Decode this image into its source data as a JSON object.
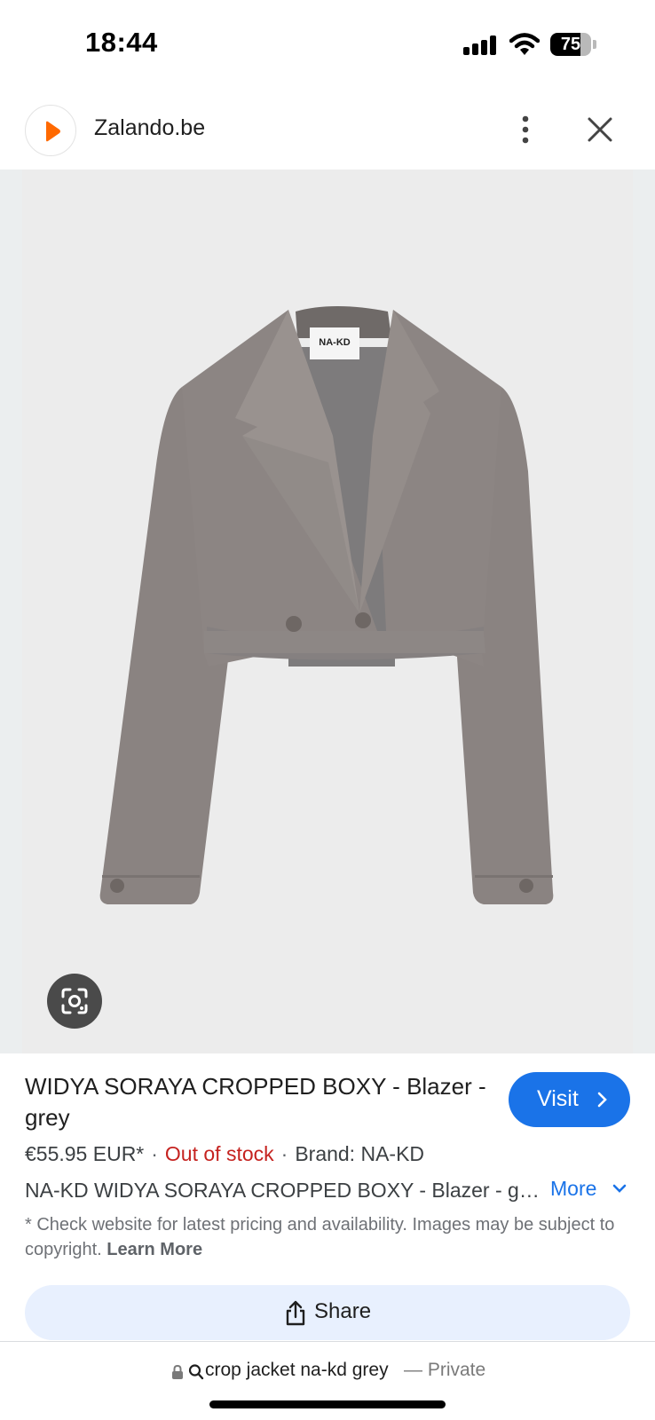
{
  "status_bar": {
    "time": "18:44",
    "battery_level": "75",
    "signal_icon": "cellular-signal-icon",
    "wifi_icon": "wifi-icon"
  },
  "browser": {
    "site_name": "Zalando.be",
    "favicon_icon": "zalando-logo-icon",
    "brand_color": "#ff6900",
    "menu_icon": "more-vertical-icon",
    "close_icon": "close-icon"
  },
  "image": {
    "label_text": "NA-KD",
    "lens_icon": "google-lens-icon"
  },
  "product": {
    "title": "WIDYA SORAYA CROPPED BOXY - Blazer - grey",
    "visit_label": "Visit",
    "price": "€55.95 EUR*",
    "separator": "·",
    "stock": "Out of stock",
    "brand": "Brand: NA-KD",
    "description": "NA-KD WIDYA SORAYA CROPPED BOXY - Blazer - grey",
    "more_label": "More",
    "disclaimer": "* Check website for latest pricing and availability. Images may be subject to copyright.",
    "learn_more": "Learn More",
    "accent_color": "#1a73e8",
    "stock_color": "#c5221f"
  },
  "share": {
    "label": "Share",
    "icon": "share-icon"
  },
  "address_bar": {
    "query": "crop jacket na-kd grey",
    "private_label": "— Private"
  }
}
